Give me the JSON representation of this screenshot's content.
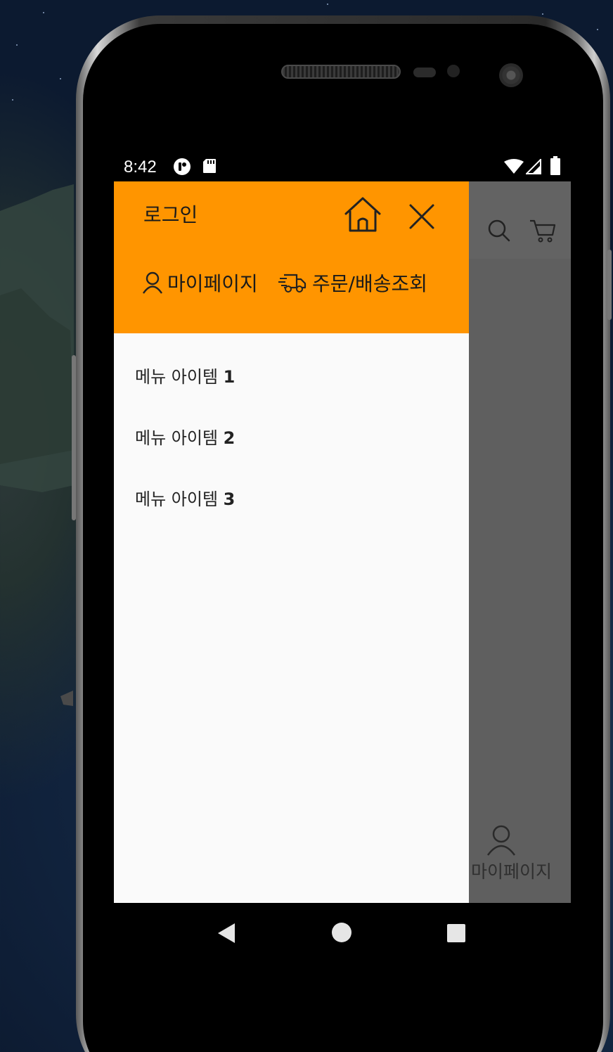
{
  "status_bar": {
    "time": "8:42",
    "left_icons": [
      "notification-app-icon",
      "sd-card-icon"
    ],
    "right_icons": [
      "wifi-icon",
      "cell-signal-icon",
      "battery-icon"
    ]
  },
  "drawer": {
    "header_color": "#ff9500",
    "login_label": "로그인",
    "home_icon": "home-icon",
    "close_icon": "close-icon",
    "mypage_label": "마이페이지",
    "mypage_icon": "user-icon",
    "order_label": "주문/배송조회",
    "order_icon": "delivery-truck-icon",
    "menu_items": [
      {
        "text": "메뉴 아이템",
        "number": "1"
      },
      {
        "text": "메뉴 아이템",
        "number": "2"
      },
      {
        "text": "메뉴 아이템",
        "number": "3"
      }
    ]
  },
  "background_app": {
    "search_icon": "search-icon",
    "cart_icon": "cart-icon",
    "tab_icon": "user-icon",
    "tab_label": "마이페이지"
  },
  "nav_bar": {
    "back_icon": "back-triangle-icon",
    "home_icon": "home-circle-icon",
    "recents_icon": "recents-square-icon"
  }
}
